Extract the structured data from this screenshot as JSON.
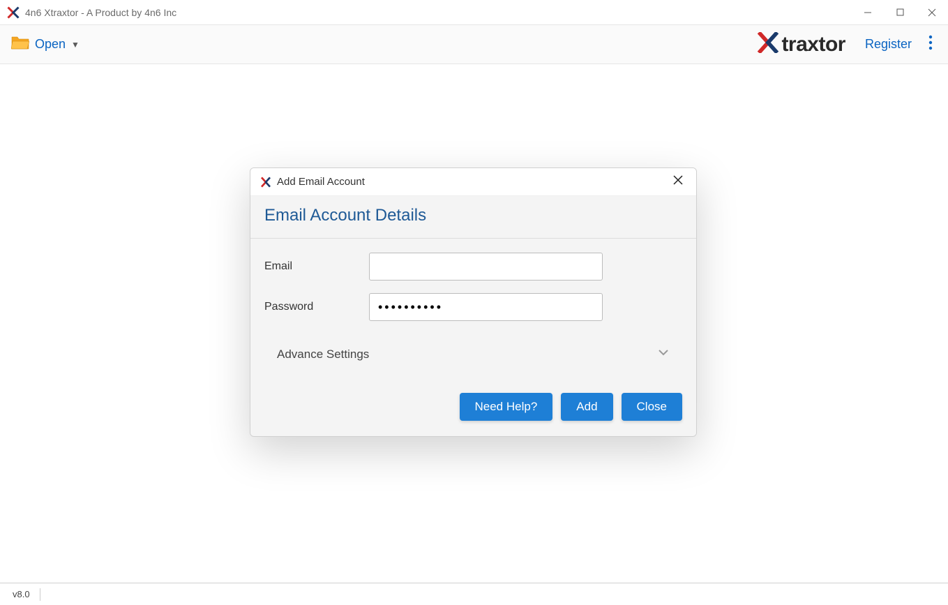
{
  "window": {
    "title": "4n6 Xtraxtor - A Product by 4n6 Inc"
  },
  "toolbar": {
    "open_label": "Open",
    "logo_text": "traxtor",
    "register_label": "Register"
  },
  "dialog": {
    "title": "Add Email Account",
    "header": "Email Account Details",
    "email_label": "Email",
    "email_value": "",
    "password_label": "Password",
    "password_value": "••••••••••",
    "advance_label": "Advance Settings",
    "actions": {
      "need_help": "Need Help?",
      "add": "Add",
      "close": "Close"
    }
  },
  "statusbar": {
    "version": "v8.0"
  }
}
